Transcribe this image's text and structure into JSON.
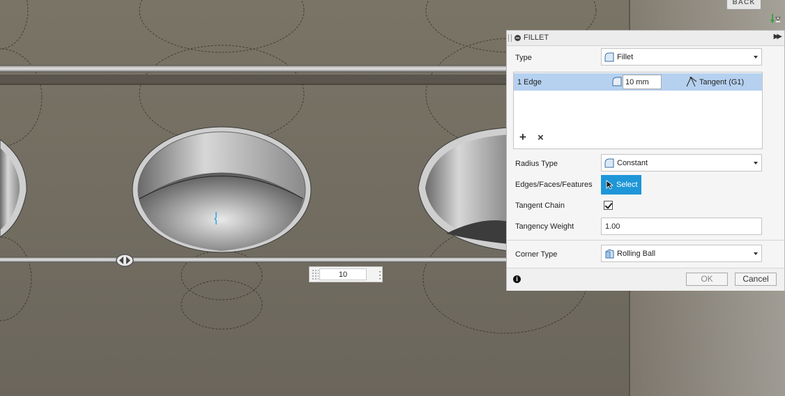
{
  "viewcube": {
    "label": "BACK"
  },
  "canvas": {
    "dimension_value": "10"
  },
  "dialog": {
    "title": "FILLET",
    "type": {
      "label": "Type",
      "value": "Fillet"
    },
    "selection_list": {
      "row": {
        "label": "1 Edge",
        "radius": "10 mm",
        "continuity": "Tangent (G1)"
      },
      "add_label": "+",
      "remove_label": "×"
    },
    "radius_type": {
      "label": "Radius Type",
      "value": "Constant"
    },
    "edges_faces_features": {
      "label": "Edges/Faces/Features",
      "button_label": "Select"
    },
    "tangent_chain": {
      "label": "Tangent Chain",
      "checked": true
    },
    "tangency_weight": {
      "label": "Tangency Weight",
      "value": "1.00"
    },
    "corner_type": {
      "label": "Corner Type",
      "value": "Rolling Ball"
    },
    "ok_label": "OK",
    "cancel_label": "Cancel"
  },
  "colors": {
    "select_button": "#1e96d8",
    "selected_row": "#b6d1f0",
    "model_surface": "#6f6a60"
  }
}
